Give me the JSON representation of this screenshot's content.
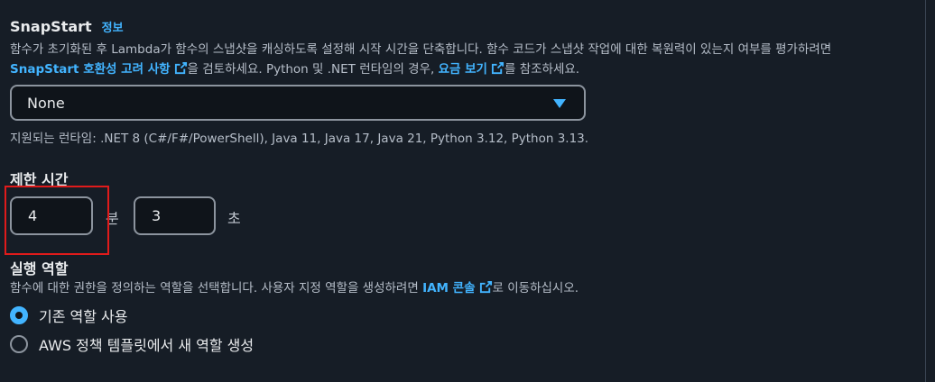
{
  "snapstart": {
    "label": "SnapStart",
    "info_link": "정보",
    "desc_part1": "함수가 초기화된 후 Lambda가 함수의 스냅샷을 캐싱하도록 설정해 시작 시간을 단축합니다. 함수 코드가 스냅샷 작업에 대한 복원력이 있는지 여부를 평가하려면 ",
    "compat_link": "SnapStart 호환성 고려 사항",
    "desc_part2": "을 검토하세요. Python 및 .NET 런타임의 경우, ",
    "pricing_link": "요금 보기",
    "desc_part3": "를 참조하세요.",
    "select_value": "None",
    "supported_runtimes": "지원되는 런타임: .NET 8 (C#/F#/PowerShell), Java 11, Java 17, Java 21, Python 3.12, Python 3.13."
  },
  "timeout": {
    "label": "제한 시간",
    "minutes_value": "4",
    "minutes_unit": "분",
    "seconds_value": "3",
    "seconds_unit": "초"
  },
  "execution_role": {
    "label": "실행 역할",
    "desc_part1": "함수에 대한 권한을 정의하는 역할을 선택합니다. 사용자 지정 역할을 생성하려면 ",
    "iam_link": "IAM 콘솔",
    "desc_part2": "로 이동하십시오.",
    "options": [
      {
        "label": "기존 역할 사용",
        "checked": true
      },
      {
        "label": "AWS 정책 템플릿에서 새 역할 생성",
        "checked": false
      }
    ]
  },
  "colors": {
    "background": "#161d26",
    "accent": "#42b4ff",
    "highlight": "#e01b1b"
  }
}
